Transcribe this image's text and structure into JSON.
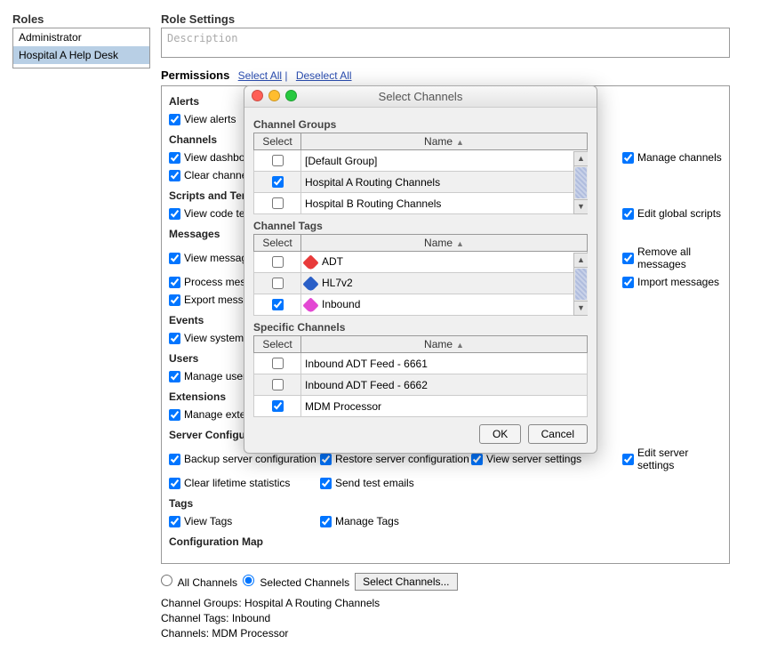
{
  "roles_panel": {
    "title": "Roles",
    "items": [
      "Administrator",
      "Hospital A Help Desk"
    ],
    "selected_index": 1
  },
  "settings": {
    "title": "Role Settings",
    "description_placeholder": "Description",
    "permissions_label": "Permissions",
    "select_all": "Select All",
    "deselect_all": "Deselect All"
  },
  "groups": {
    "alerts": {
      "title": "Alerts",
      "view": "View alerts"
    },
    "channels": {
      "title": "Channels",
      "view_dash": "View dashboard",
      "manage": "Manage channels",
      "clear": "Clear channels"
    },
    "scripts": {
      "title": "Scripts and Templates",
      "view_code": "View code templates",
      "edit_global": "Edit global scripts"
    },
    "messages": {
      "title": "Messages",
      "view": "View messages",
      "remove_all": "Remove all messages",
      "process": "Process messages",
      "import": "Import messages",
      "export": "Export messages"
    },
    "events": {
      "title": "Events",
      "view": "View system events"
    },
    "users": {
      "title": "Users",
      "manage": "Manage users"
    },
    "extensions": {
      "title": "Extensions",
      "manage": "Manage extensions"
    },
    "server": {
      "title": "Server Configuration and Settings",
      "backup": "Backup server configuration",
      "restore": "Restore server configuration",
      "view": "View server settings",
      "edit": "Edit server settings",
      "clear": "Clear lifetime statistics",
      "send_test": "Send test emails"
    },
    "tags": {
      "title": "Tags",
      "view": "View Tags",
      "manage": "Manage Tags"
    },
    "config_map": {
      "title": "Configuration Map"
    }
  },
  "channel_selection": {
    "all_label": "All Channels",
    "selected_label": "Selected Channels",
    "button": "Select Channels...",
    "summary_groups": "Channel Groups: Hospital A Routing Channels",
    "summary_tags": "Channel Tags: Inbound",
    "summary_channels": "Channels: MDM Processor"
  },
  "dialog": {
    "title": "Select Channels",
    "section_groups": "Channel Groups",
    "section_tags": "Channel Tags",
    "section_specific": "Specific Channels",
    "col_select": "Select",
    "col_name": "Name",
    "groups": [
      {
        "selected": false,
        "name": "[Default Group]"
      },
      {
        "selected": true,
        "name": "Hospital A Routing Channels"
      },
      {
        "selected": false,
        "name": "Hospital B Routing Channels"
      }
    ],
    "tags": [
      {
        "selected": false,
        "name": "ADT",
        "color": "red"
      },
      {
        "selected": false,
        "name": "HL7v2",
        "color": "blue"
      },
      {
        "selected": true,
        "name": "Inbound",
        "color": "pink"
      }
    ],
    "channels": [
      {
        "selected": false,
        "name": "Inbound ADT Feed - 6661"
      },
      {
        "selected": false,
        "name": "Inbound ADT Feed - 6662"
      },
      {
        "selected": true,
        "name": "MDM Processor"
      }
    ],
    "ok": "OK",
    "cancel": "Cancel"
  }
}
